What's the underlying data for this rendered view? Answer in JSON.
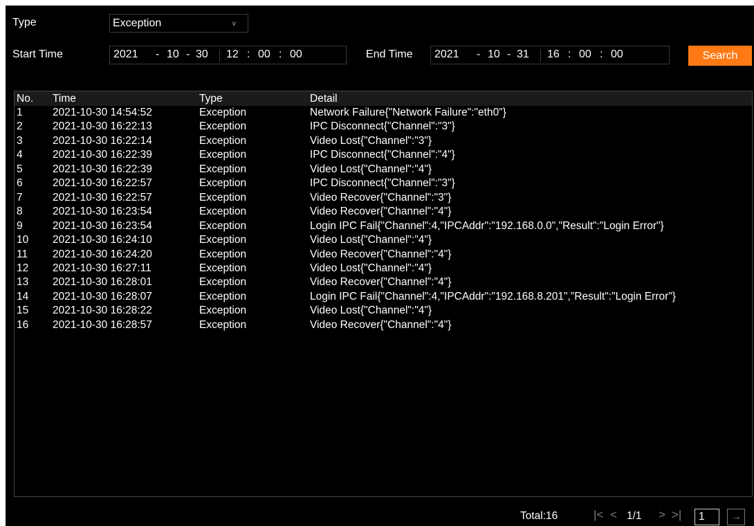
{
  "filters": {
    "type_label": "Type",
    "type_value": "Exception",
    "start_label": "Start Time",
    "start": {
      "year": "2021",
      "month": "10",
      "day": "30",
      "hour": "12",
      "minute": "00",
      "second": "00"
    },
    "end_label": "End Time",
    "end": {
      "year": "2021",
      "month": "10",
      "day": "31",
      "hour": "16",
      "minute": "00",
      "second": "00"
    },
    "date_sep": "-",
    "time_sep": ":",
    "search_label": "Search"
  },
  "table": {
    "columns": [
      "No.",
      "Time",
      "Type",
      "Detail"
    ],
    "rows": [
      {
        "no": "1",
        "time": "2021-10-30 14:54:52",
        "type": "Exception",
        "detail": "Network Failure{\"Network Failure\":\"eth0\"}"
      },
      {
        "no": "2",
        "time": "2021-10-30 16:22:13",
        "type": "Exception",
        "detail": "IPC Disconnect{\"Channel\":\"3\"}"
      },
      {
        "no": "3",
        "time": "2021-10-30 16:22:14",
        "type": "Exception",
        "detail": "Video Lost{\"Channel\":\"3\"}"
      },
      {
        "no": "4",
        "time": "2021-10-30 16:22:39",
        "type": "Exception",
        "detail": "IPC Disconnect{\"Channel\":\"4\"}"
      },
      {
        "no": "5",
        "time": "2021-10-30 16:22:39",
        "type": "Exception",
        "detail": "Video Lost{\"Channel\":\"4\"}"
      },
      {
        "no": "6",
        "time": "2021-10-30 16:22:57",
        "type": "Exception",
        "detail": "IPC Disconnect{\"Channel\":\"3\"}"
      },
      {
        "no": "7",
        "time": "2021-10-30 16:22:57",
        "type": "Exception",
        "detail": "Video Recover{\"Channel\":\"3\"}"
      },
      {
        "no": "8",
        "time": "2021-10-30 16:23:54",
        "type": "Exception",
        "detail": "Video Recover{\"Channel\":\"4\"}"
      },
      {
        "no": "9",
        "time": "2021-10-30 16:23:54",
        "type": "Exception",
        "detail": "Login IPC Fail{\"Channel\":4,\"IPCAddr\":\"192.168.0.0\",\"Result\":\"Login Error\"}"
      },
      {
        "no": "10",
        "time": "2021-10-30 16:24:10",
        "type": "Exception",
        "detail": "Video Lost{\"Channel\":\"4\"}"
      },
      {
        "no": "11",
        "time": "2021-10-30 16:24:20",
        "type": "Exception",
        "detail": "Video Recover{\"Channel\":\"4\"}"
      },
      {
        "no": "12",
        "time": "2021-10-30 16:27:11",
        "type": "Exception",
        "detail": "Video Lost{\"Channel\":\"4\"}"
      },
      {
        "no": "13",
        "time": "2021-10-30 16:28:01",
        "type": "Exception",
        "detail": "Video Recover{\"Channel\":\"4\"}"
      },
      {
        "no": "14",
        "time": "2021-10-30 16:28:07",
        "type": "Exception",
        "detail": "Login IPC Fail{\"Channel\":4,\"IPCAddr\":\"192.168.8.201\",\"Result\":\"Login Error\"}"
      },
      {
        "no": "15",
        "time": "2021-10-30 16:28:22",
        "type": "Exception",
        "detail": "Video Lost{\"Channel\":\"4\"}"
      },
      {
        "no": "16",
        "time": "2021-10-30 16:28:57",
        "type": "Exception",
        "detail": "Video Recover{\"Channel\":\"4\"}"
      }
    ]
  },
  "pager": {
    "total_label": "Total:16",
    "page_indicator": "1/1",
    "first_icon": "first-page-icon",
    "prev_icon": "prev-page-icon",
    "next_icon": "next-page-icon",
    "last_icon": "last-page-icon",
    "page_input_value": "1",
    "go_icon": "arrow-right-icon"
  },
  "colors": {
    "background": "#000000",
    "accent": "#ff7a15",
    "header_row": "#1b1b1b",
    "border": "#444444"
  }
}
